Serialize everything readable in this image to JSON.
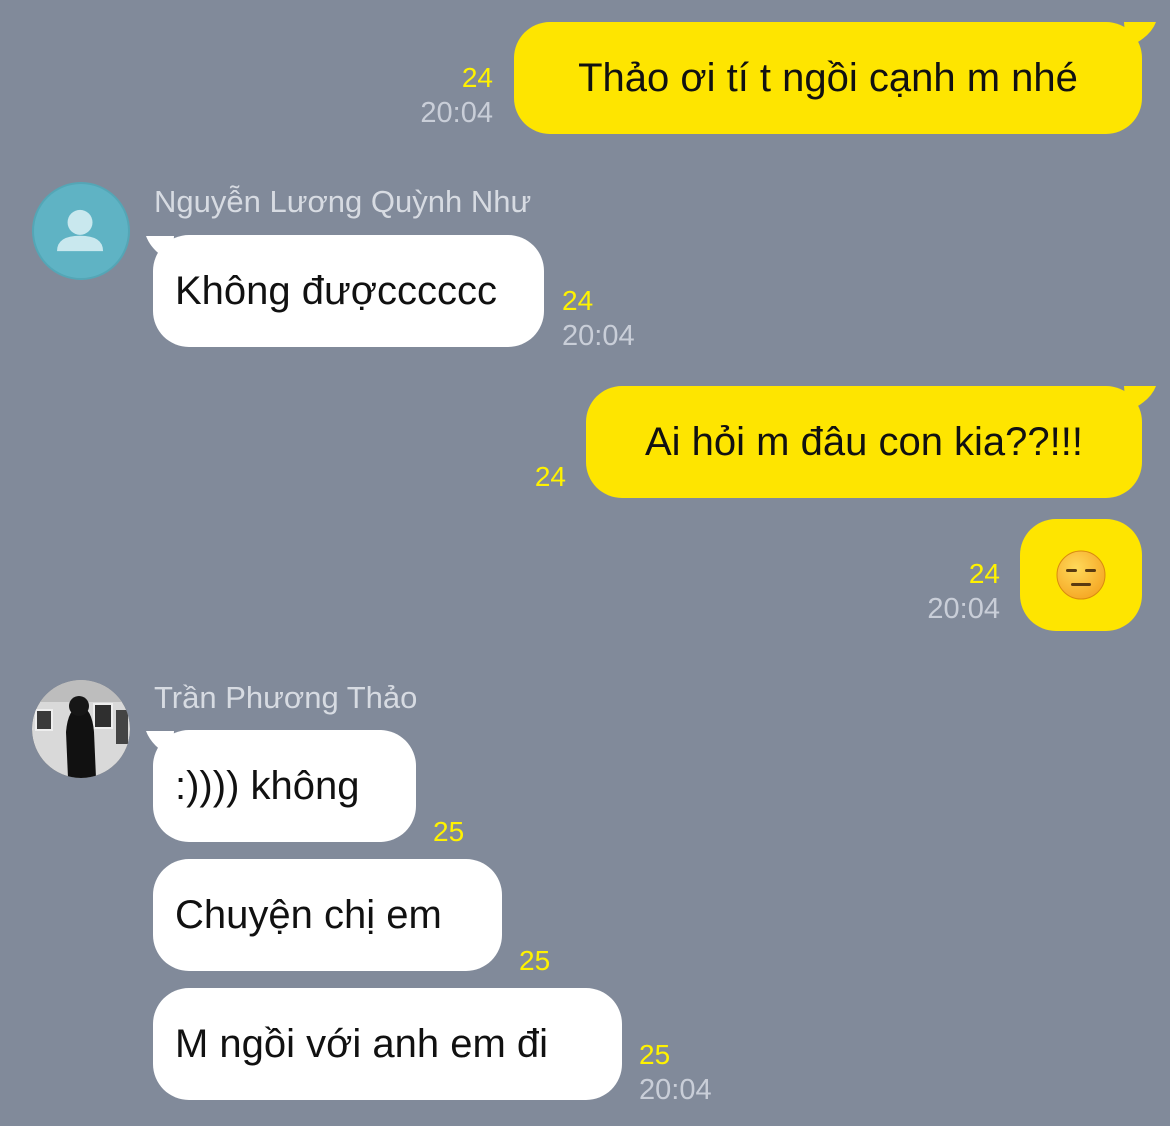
{
  "theme": {
    "background": "#818a9a",
    "outgoing_bubble": "#fee500",
    "incoming_bubble": "#ffffff",
    "unread_count_color": "#fff200",
    "timestamp_color": "#c9ced8"
  },
  "messages": [
    {
      "direction": "outgoing",
      "text": "Thảo ơi tí t ngồi cạnh m nhé",
      "unread": "24",
      "time": "20:04"
    },
    {
      "direction": "incoming",
      "sender": "Nguyễn Lương Quỳnh Như",
      "avatar": "default-person-icon",
      "text": "Không đượcccccc",
      "unread": "24",
      "time": "20:04"
    },
    {
      "direction": "outgoing",
      "text": "Ai hỏi m đâu con kia??!!!",
      "unread": "24"
    },
    {
      "direction": "outgoing",
      "emoji": "expressionless-face-icon",
      "unread": "24",
      "time": "20:04"
    },
    {
      "direction": "incoming",
      "sender": "Trần Phương Thảo",
      "avatar": "photo-avatar",
      "text": ":)))) không",
      "unread": "25"
    },
    {
      "direction": "incoming",
      "text": "Chuyện chị em",
      "unread": "25"
    },
    {
      "direction": "incoming",
      "text": "M ngồi với anh em đi",
      "unread": "25",
      "time": "20:04"
    }
  ]
}
